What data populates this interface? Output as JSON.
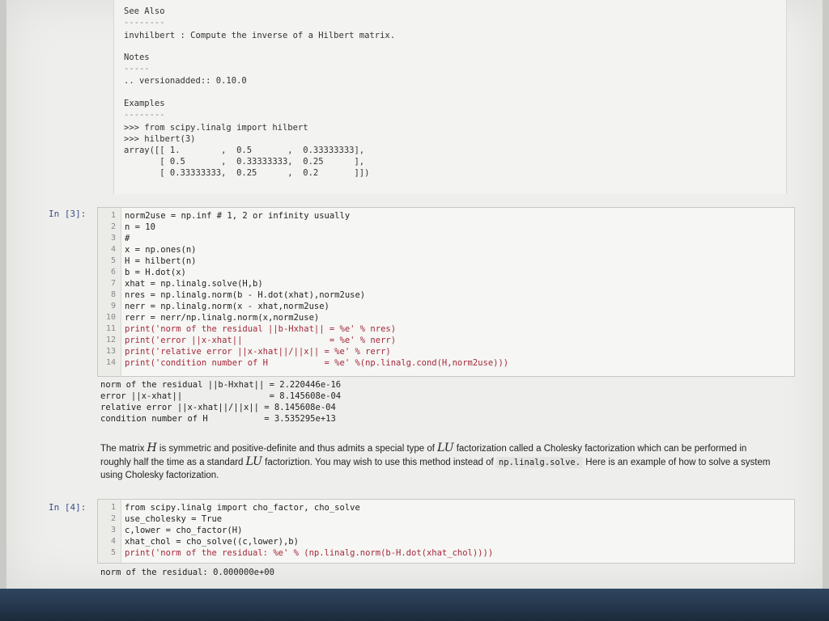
{
  "docstring": {
    "lines": [
      "See Also",
      "--------",
      "invhilbert : Compute the inverse of a Hilbert matrix.",
      "Notes",
      "-----",
      ".. versionadded:: 0.10.0",
      "Examples",
      "--------",
      ">>> from scipy.linalg import hilbert",
      ">>> hilbert(3)",
      "array([[ 1.        ,  0.5       ,  0.33333333],",
      "       [ 0.5       ,  0.33333333,  0.25      ],",
      "       [ 0.33333333,  0.25      ,  0.2       ]])"
    ]
  },
  "cell3": {
    "prompt": "In [3]:",
    "lines": [
      {
        "n": "1",
        "code": "norm2use = np.inf # 1, 2 or infinity usually"
      },
      {
        "n": "2",
        "code": "n = 10"
      },
      {
        "n": "3",
        "code": "#"
      },
      {
        "n": "4",
        "code": "x = np.ones(n)"
      },
      {
        "n": "5",
        "code": "H = hilbert(n)"
      },
      {
        "n": "6",
        "code": "b = H.dot(x)"
      },
      {
        "n": "7",
        "code": "xhat = np.linalg.solve(H,b)"
      },
      {
        "n": "8",
        "code": "nres = np.linalg.norm(b - H.dot(xhat),norm2use)"
      },
      {
        "n": "9",
        "code": "nerr = np.linalg.norm(x - xhat,norm2use)"
      },
      {
        "n": "10",
        "code": "rerr = nerr/np.linalg.norm(x,norm2use)"
      },
      {
        "n": "11",
        "code": "print('norm of the residual ||b-Hxhat|| = %e' % nres)"
      },
      {
        "n": "12",
        "code": "print('error ||x-xhat||                 = %e' % nerr)"
      },
      {
        "n": "13",
        "code": "print('relative error ||x-xhat||/||x|| = %e' % rerr)"
      },
      {
        "n": "14",
        "code": "print('condition number of H           = %e' %(np.linalg.cond(H,norm2use)))"
      }
    ],
    "output": [
      "norm of the residual ||b-Hxhat|| = 2.220446e-16",
      "error ||x-xhat||                 = 8.145608e-04",
      "relative error ||x-xhat||/||x|| = 8.145608e-04",
      "condition number of H           = 3.535295e+13"
    ]
  },
  "markdown": {
    "p1": "The matrix ",
    "var_H": "H",
    "p2": " is symmetric and positive-definite and thus admits a special type of ",
    "var_LU": "LU",
    "p3": " factorization called a Cholesky factorization which can be performed in roughly half the time as a standard ",
    "var_LU2": "LU",
    "p4": " factoriztion. You may wish to use this method instead of ",
    "code_solve": "np.linalg.solve.",
    "p5": " Here is an example of how to solve a system using Cholesky factorization."
  },
  "cell4": {
    "prompt": "In [4]:",
    "lines": [
      {
        "n": "1",
        "code": "from scipy.linalg import cho_factor, cho_solve"
      },
      {
        "n": "2",
        "code": "use_cholesky = True"
      },
      {
        "n": "3",
        "code": "c,lower = cho_factor(H)"
      },
      {
        "n": "4",
        "code": "xhat_chol = cho_solve((c,lower),b)"
      },
      {
        "n": "5",
        "code": "print('norm of the residual: %e' % (np.linalg.norm(b-H.dot(xhat_chol))))"
      }
    ],
    "output": "norm of the residual: 0.000000e+00"
  }
}
